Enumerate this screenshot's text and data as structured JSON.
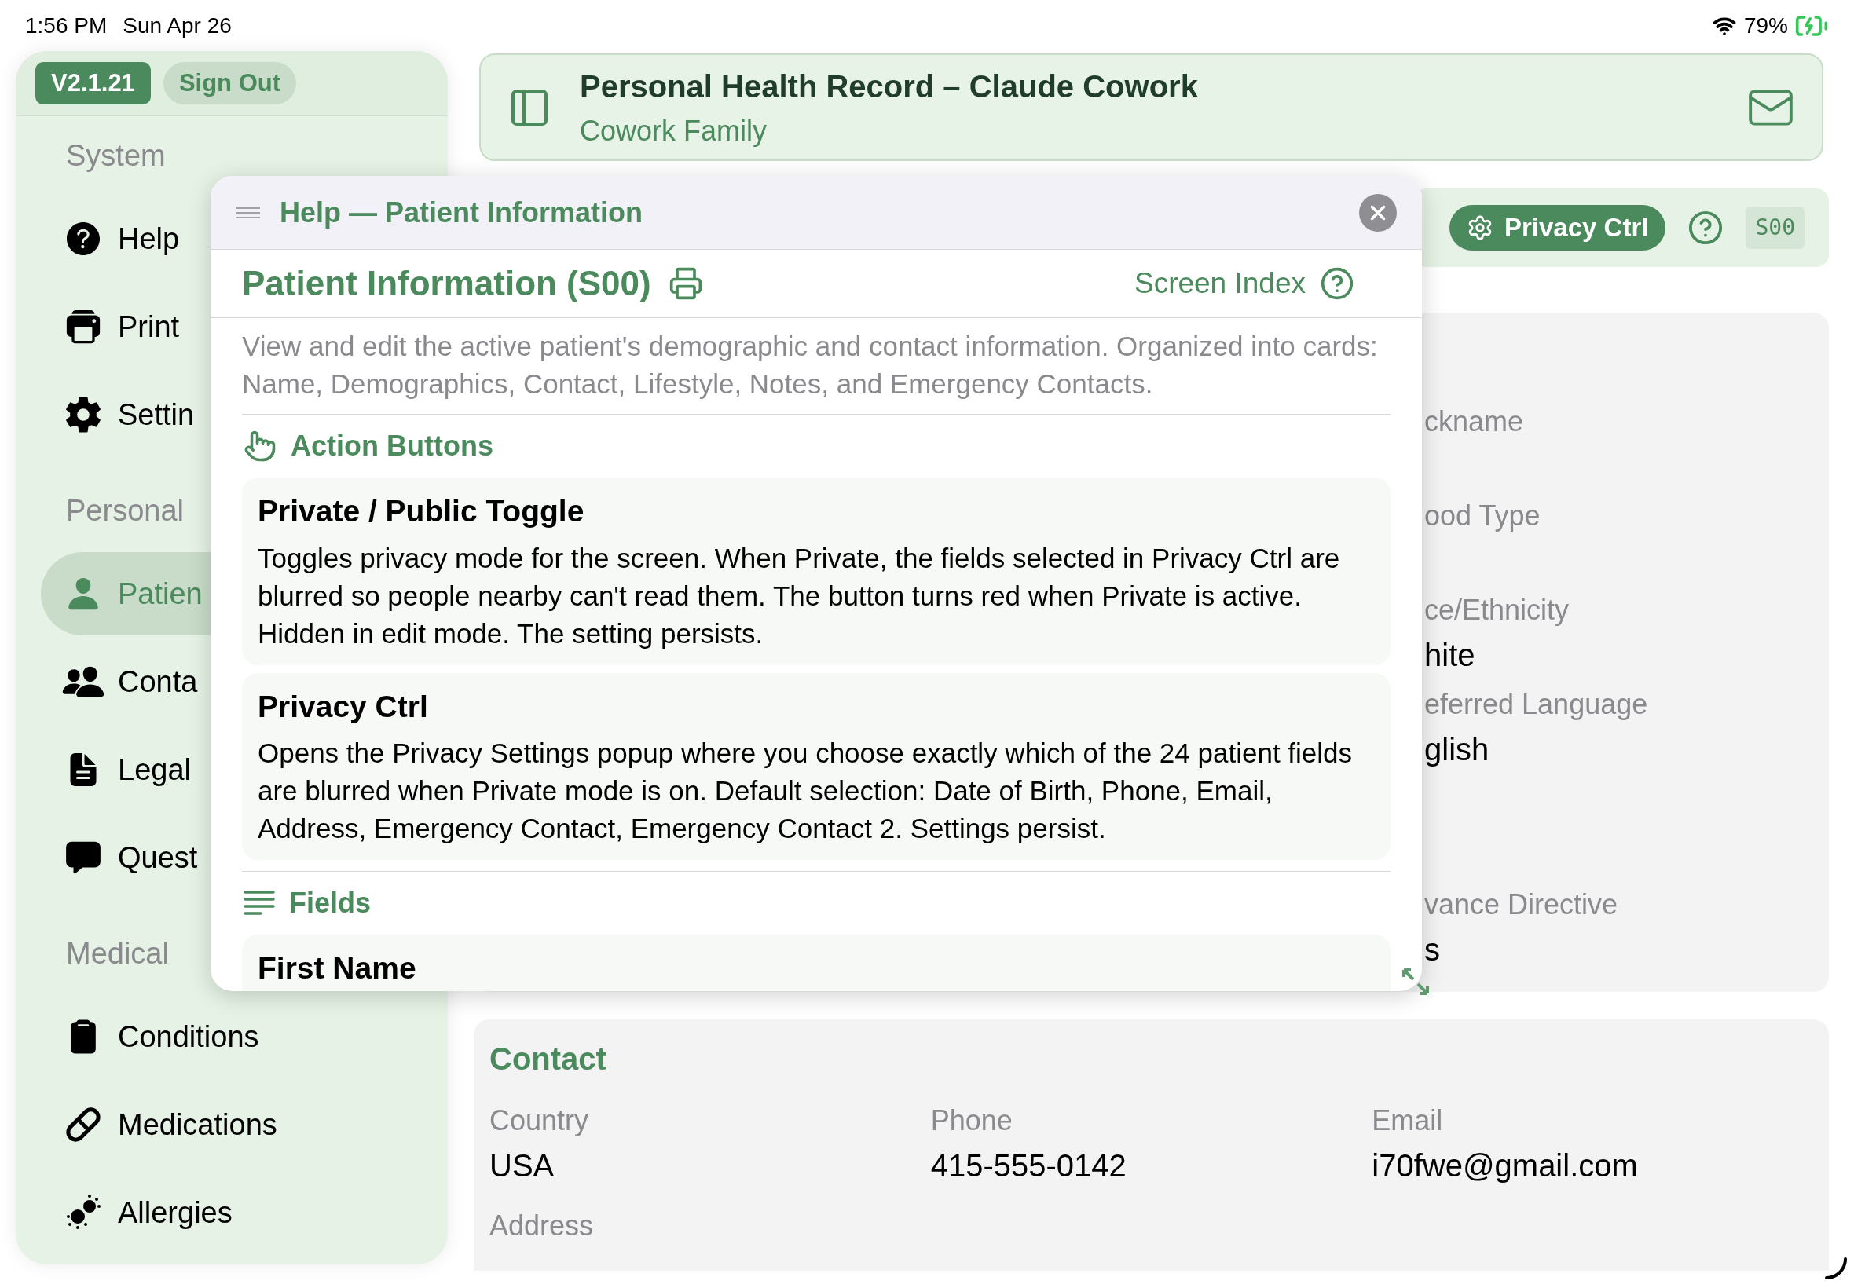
{
  "status_bar": {
    "time": "1:56 PM",
    "date": "Sun Apr 26",
    "battery": "79%"
  },
  "sidebar": {
    "version": "V2.1.21",
    "sign_out": "Sign Out",
    "sections": [
      {
        "title": "System",
        "items": [
          {
            "label": "Help",
            "selected": false
          },
          {
            "label": "Print",
            "selected": false
          },
          {
            "label": "Settin",
            "selected": false
          }
        ]
      },
      {
        "title": "Personal",
        "items": [
          {
            "label": "Patien",
            "selected": true
          },
          {
            "label": "Conta",
            "selected": false
          },
          {
            "label": "Legal",
            "selected": false
          },
          {
            "label": "Quest",
            "selected": false
          }
        ]
      },
      {
        "title": "Medical",
        "items": [
          {
            "label": "Conditions",
            "selected": false
          },
          {
            "label": "Medications",
            "selected": false
          },
          {
            "label": "Allergies",
            "selected": false
          }
        ]
      }
    ]
  },
  "header": {
    "title": "Personal Health Record – Claude Cowork",
    "subtitle": "Cowork Family"
  },
  "toolbar": {
    "privacy_button": "Privacy Ctrl",
    "screen_code": "S00"
  },
  "demographics": {
    "fields": [
      {
        "label": "ckname"
      },
      {
        "label": "ood Type"
      },
      {
        "label": "ce/Ethnicity",
        "value": "hite"
      },
      {
        "label": "eferred Language",
        "value": "glish"
      },
      {
        "label": "vance Directive",
        "value": "s"
      }
    ]
  },
  "contact": {
    "title": "Contact",
    "fields": [
      {
        "label": "Country",
        "value": "USA"
      },
      {
        "label": "Phone",
        "value": "415-555-0142"
      },
      {
        "label": "Email",
        "value": "i70fwe@gmail.com"
      },
      {
        "label": "Address"
      }
    ]
  },
  "help_popup": {
    "title": "Help — Patient Information",
    "heading": "Patient Information (S00)",
    "screen_index": "Screen Index",
    "description": "View and edit the active patient's demographic and contact information. Organized into cards: Name, Demographics, Contact, Lifestyle, Notes, and Emergency Contacts.",
    "sections": [
      {
        "kind": "actions",
        "title": "Action Buttons",
        "entries": [
          {
            "title": "Private / Public Toggle",
            "body": "Toggles privacy mode for the screen. When Private, the fields selected in Privacy Ctrl are blurred so people nearby can't read them. The button turns red when Private is active. Hidden in edit mode. The setting persists."
          },
          {
            "title": "Privacy Ctrl",
            "body": "Opens the Privacy Settings popup where you choose exactly which of the 24 patient fields are blurred when Private mode is on. Default selection: Date of Birth, Phone, Email, Address, Emergency Contact, Emergency Contact 2. Settings persist."
          }
        ]
      },
      {
        "kind": "fields",
        "title": "Fields",
        "entries": [
          {
            "title": "First Name"
          }
        ]
      }
    ]
  }
}
